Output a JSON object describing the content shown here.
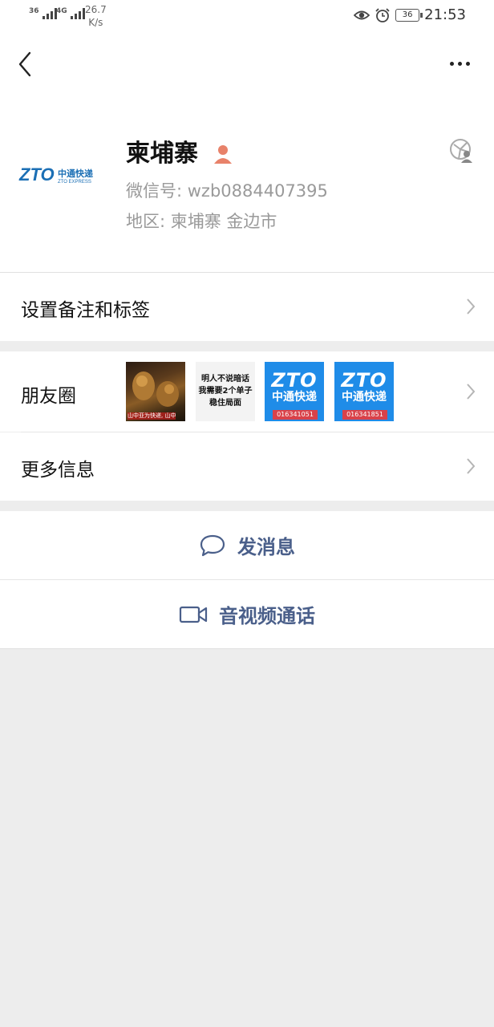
{
  "status_bar": {
    "sim1": "36",
    "sim2": "4G",
    "speed_value": "26.7",
    "speed_unit": "K/s",
    "battery": "36",
    "time": "21:53"
  },
  "profile": {
    "name": "柬埔寨",
    "wechat_id": "微信号: wzb0884407395",
    "region": "地区: 柬埔寨  金边市",
    "avatar_logo": "ZTO",
    "avatar_cn": "中通快递",
    "avatar_en": "ZTO EXPRESS"
  },
  "rows": {
    "remark": "设置备注和标签",
    "moments": "朋友圈",
    "more_info": "更多信息"
  },
  "moments_thumbs": [
    {
      "kind": "photo",
      "caption": "山中亚为快递, 山中"
    },
    {
      "kind": "text",
      "lines": [
        "明人不说暗话",
        "我需要2个单子",
        "稳住局面"
      ]
    },
    {
      "kind": "zto",
      "logo": "ZTO",
      "cn": "中通快递",
      "number": "016341051"
    },
    {
      "kind": "zto",
      "logo": "ZTO",
      "cn": "中通快递",
      "number": "016341851"
    }
  ],
  "actions": {
    "message": "发消息",
    "call": "音视频通话"
  },
  "colors": {
    "action_text": "#4a5f8a",
    "background": "#ededed",
    "zto_blue": "#1f8ce8",
    "gender_icon": "#e8826a"
  }
}
